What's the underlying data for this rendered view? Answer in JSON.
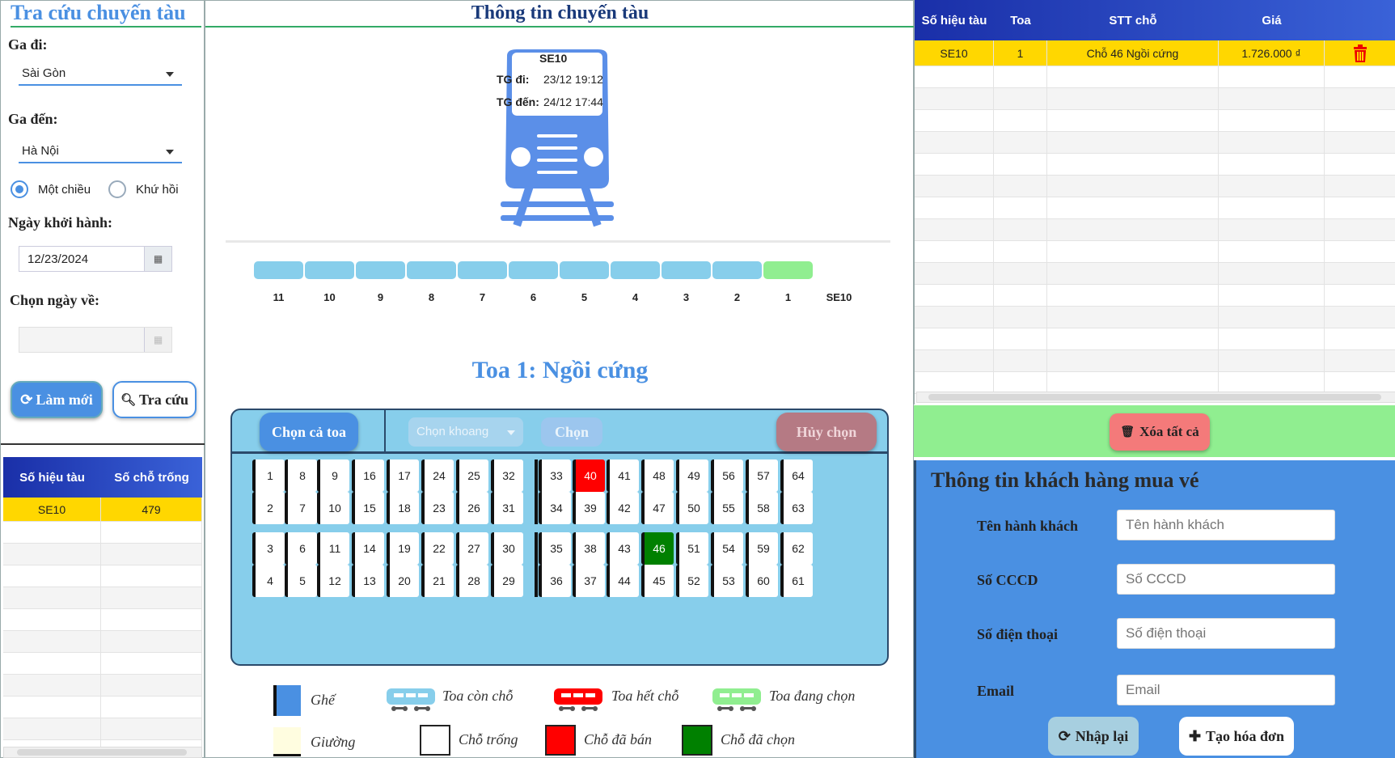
{
  "search": {
    "title": "Tra cứu chuyến tàu",
    "from_label": "Ga đi:",
    "from_value": "Sài Gòn",
    "to_label": "Ga đến:",
    "to_value": "Hà Nội",
    "trip_one_way": "Một chiều",
    "trip_round": "Khứ hồi",
    "depart_label": "Ngày khởi hành:",
    "depart_value": "12/23/2024",
    "return_label": "Chọn ngày về:",
    "return_value": "",
    "refresh_btn": "Làm mới",
    "search_btn": "Tra cứu"
  },
  "trains_table": {
    "headers": [
      "Số hiệu tàu",
      "Số chỗ trống"
    ],
    "rows": [
      [
        "SE10",
        "479"
      ]
    ]
  },
  "train_info": {
    "title": "Thông tin chuyến tàu",
    "code": "SE10",
    "depart_label": "TG đi:",
    "depart_time": "23/12 19:12",
    "arrive_label": "TG đến:",
    "arrive_time": "24/12 17:44",
    "cars": [
      "11",
      "10",
      "9",
      "8",
      "7",
      "6",
      "5",
      "4",
      "3",
      "2",
      "1"
    ],
    "active_car": "1",
    "locomotive_label": "SE10"
  },
  "coach": {
    "title": "Toa 1: Ngồi cứng",
    "select_all_btn": "Chọn cả toa",
    "compartment_placeholder": "Chọn khoang",
    "choose_btn": "Chọn",
    "cancel_btn": "Hủy chọn",
    "seats_top": [
      [
        "1",
        "8",
        "9",
        "16",
        "17",
        "24",
        "25",
        "32",
        "33",
        "40",
        "41",
        "48",
        "49",
        "56",
        "57",
        "64"
      ],
      [
        "2",
        "7",
        "10",
        "15",
        "18",
        "23",
        "26",
        "31",
        "34",
        "39",
        "42",
        "47",
        "50",
        "55",
        "58",
        "63"
      ]
    ],
    "seats_bottom": [
      [
        "3",
        "6",
        "11",
        "14",
        "19",
        "22",
        "27",
        "30",
        "35",
        "38",
        "43",
        "46",
        "51",
        "54",
        "59",
        "62"
      ],
      [
        "4",
        "5",
        "12",
        "13",
        "20",
        "21",
        "28",
        "29",
        "36",
        "37",
        "44",
        "45",
        "52",
        "53",
        "60",
        "61"
      ]
    ],
    "sold": [
      "40"
    ],
    "chosen": [
      "46"
    ]
  },
  "legend": {
    "seat": "Ghế",
    "bed": "Giường",
    "car_available": "Toa còn chỗ",
    "car_full": "Toa hết chỗ",
    "car_selected": "Toa đang chọn",
    "seat_empty": "Chỗ trống",
    "seat_sold": "Chỗ đã bán",
    "seat_chosen": "Chỗ đã chọn"
  },
  "cart": {
    "headers": [
      "Số hiệu tàu",
      "Toa",
      "STT chỗ",
      "Giá"
    ],
    "rows": [
      [
        "SE10",
        "1",
        "Chỗ 46 Ngồi cứng",
        "1.726.000 ₫"
      ]
    ],
    "clear_all_btn": "Xóa tất cả"
  },
  "customer": {
    "title": "Thông tin khách hàng mua vé",
    "name_label": "Tên hành khách",
    "name_placeholder": "Tên hành khách",
    "id_label": "Số CCCD",
    "id_placeholder": "Số CCCD",
    "phone_label": "Số điện thoại",
    "phone_placeholder": "Số điện thoại",
    "email_label": "Email",
    "email_placeholder": "Email",
    "reset_btn": "Nhập lại",
    "invoice_btn": "Tạo hóa đơn"
  },
  "colors": {
    "accent": "#4a90e2",
    "sold": "#ff0000",
    "chosen": "#008000",
    "car_active": "#90ee90",
    "car_available": "#87ceeb",
    "selected_row": "#ffd700"
  }
}
